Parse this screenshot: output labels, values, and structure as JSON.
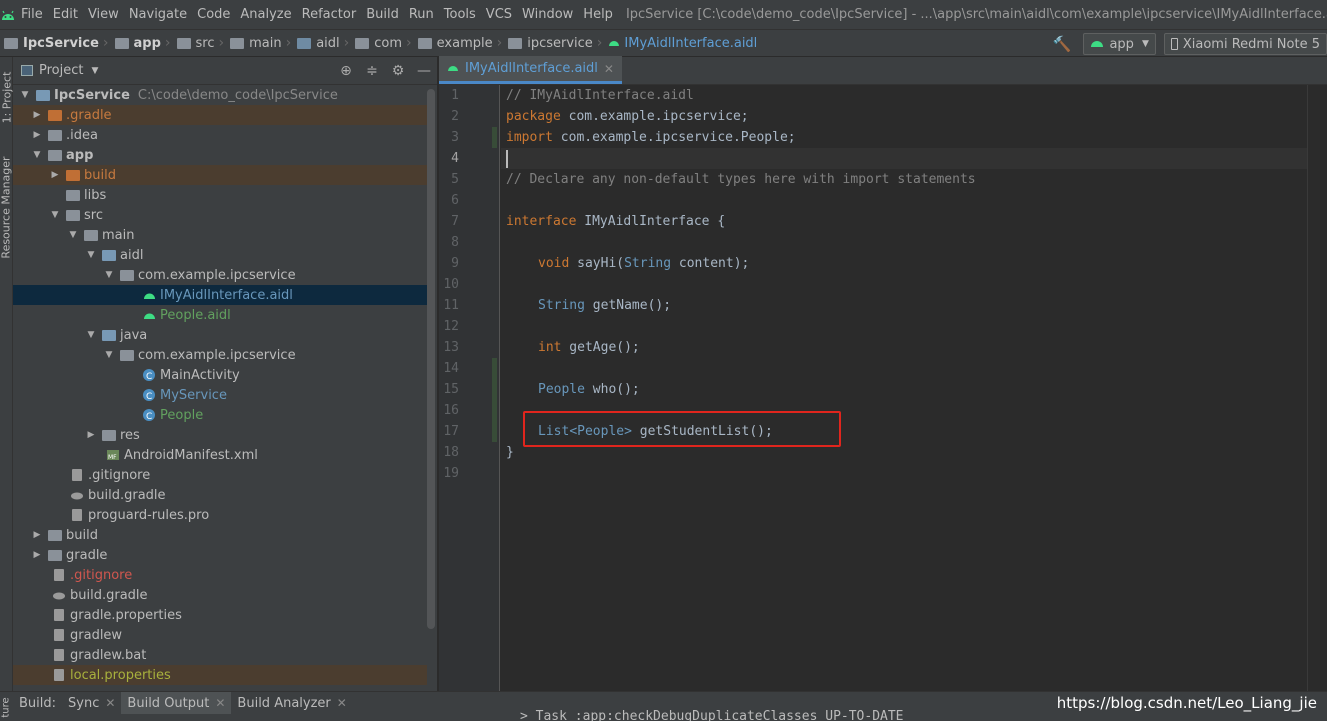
{
  "menubar": {
    "items": [
      "File",
      "Edit",
      "View",
      "Navigate",
      "Code",
      "Analyze",
      "Refactor",
      "Build",
      "Run",
      "Tools",
      "VCS",
      "Window",
      "Help"
    ],
    "window_title": "IpcService [C:\\code\\demo_code\\IpcService] - ...\\app\\src\\main\\aidl\\com\\example\\ipcservice\\IMyAidlInterface.aidl [app] - Ar"
  },
  "breadcrumbs": [
    "IpcService",
    "app",
    "src",
    "main",
    "aidl",
    "com",
    "example",
    "ipcservice",
    "IMyAidlInterface.aidl"
  ],
  "toolbar": {
    "run_config": "app",
    "device": "Xiaomi Redmi Note 5"
  },
  "left_strip": {
    "project_tab": "1: Project",
    "resource_tab": "Resource Manager"
  },
  "project_panel": {
    "title": "Project",
    "tree": [
      {
        "label": "IpcService",
        "hint": "C:\\code\\demo_code\\IpcService"
      },
      {
        "label": ".gradle"
      },
      {
        "label": ".idea"
      },
      {
        "label": "app"
      },
      {
        "label": "build"
      },
      {
        "label": "libs"
      },
      {
        "label": "src"
      },
      {
        "label": "main"
      },
      {
        "label": "aidl"
      },
      {
        "label": "com.example.ipcservice"
      },
      {
        "label": "IMyAidlInterface.aidl"
      },
      {
        "label": "People.aidl"
      },
      {
        "label": "java"
      },
      {
        "label": "com.example.ipcservice"
      },
      {
        "label": "MainActivity"
      },
      {
        "label": "MyService"
      },
      {
        "label": "People"
      },
      {
        "label": "res"
      },
      {
        "label": "AndroidManifest.xml"
      },
      {
        "label": ".gitignore"
      },
      {
        "label": "build.gradle"
      },
      {
        "label": "proguard-rules.pro"
      },
      {
        "label": "build"
      },
      {
        "label": "gradle"
      },
      {
        "label": ".gitignore"
      },
      {
        "label": "build.gradle"
      },
      {
        "label": "gradle.properties"
      },
      {
        "label": "gradlew"
      },
      {
        "label": "gradlew.bat"
      },
      {
        "label": "local.properties"
      }
    ]
  },
  "editor": {
    "tab_label": "IMyAidlInterface.aidl",
    "line_numbers": [
      "1",
      "2",
      "3",
      "4",
      "5",
      "6",
      "7",
      "8",
      "9",
      "10",
      "11",
      "12",
      "13",
      "14",
      "15",
      "16",
      "17",
      "18",
      "19"
    ],
    "code": {
      "l1": "// IMyAidlInterface.aidl",
      "l2_kw": "package",
      "l2_rest": " com.example.ipcservice;",
      "l3_kw": "import",
      "l3_rest": " com.example.ipcservice.People;",
      "l5": "// Declare any non-default types here with import statements",
      "l7_kw": "interface",
      "l7_rest": " IMyAidlInterface {",
      "l9_kw": "void",
      "l9_mid": " sayHi(",
      "l9_type": "String",
      "l9_rest": " content);",
      "l11_type": "String",
      "l11_rest": " getName();",
      "l13_kw": "int",
      "l13_rest": " getAge();",
      "l15_type": "People",
      "l15_rest": " who();",
      "l17_type": "List",
      "l17_generic": "<People>",
      "l17_rest": " getStudentList();",
      "l18": "}"
    }
  },
  "bottom": {
    "label": "Build:",
    "tabs": [
      "Sync",
      "Build Output",
      "Build Analyzer"
    ],
    "output_line": "> Task :app:checkDebugDuplicateClasses UP-TO-DATE",
    "side_label": "ture",
    "watermark": "https://blog.csdn.net/Leo_Liang_jie"
  },
  "colors": {
    "accent": "#4a88c7",
    "keyword": "#cc7832",
    "comment": "#808080",
    "highlight_box": "#e0251d"
  }
}
